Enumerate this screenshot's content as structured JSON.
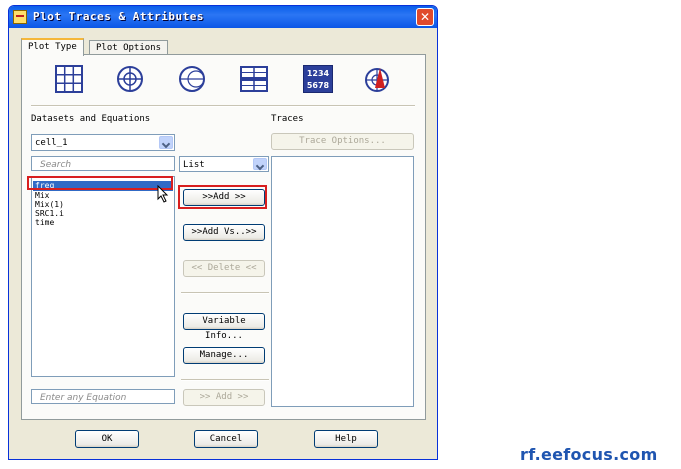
{
  "window": {
    "title": "Plot Traces & Attributes"
  },
  "tabs": [
    {
      "label": "Plot Type"
    },
    {
      "label": "Plot Options"
    }
  ],
  "plot_types": [
    "rectangular-plot-icon",
    "polar-plot-icon",
    "smith-chart-icon",
    "stacked-plot-icon",
    "data-list-icon",
    "antenna-plot-icon"
  ],
  "data_list_icon": {
    "line1": "1234",
    "line2": "5678"
  },
  "datasets": {
    "heading": "Datasets and Equations",
    "selected_dataset": "cell_1",
    "search_placeholder": "Search",
    "items": [
      "freq",
      "Mix",
      "Mix(1)",
      "SRC1.i",
      "time"
    ],
    "selected_index": 0,
    "equation_placeholder": "Enter any Equation"
  },
  "controls": {
    "view_mode": "List",
    "add_label": ">>Add >>",
    "add_vs_label": ">>Add Vs..>>",
    "delete_label": "<< Delete <<",
    "variable_info_label": "Variable Info...",
    "manage_label": "Manage...",
    "add_equation_label": ">> Add >>"
  },
  "traces": {
    "heading": "Traces",
    "trace_options_label": "Trace Options..."
  },
  "footer": {
    "ok_label": "OK",
    "cancel_label": "Cancel",
    "help_label": "Help"
  },
  "watermark": "rf.eefocus.com",
  "colors": {
    "title_bar": "#0a5ee9",
    "selection": "#316ac5",
    "highlight": "#d81e1e",
    "watermark": "#1f55b0"
  }
}
